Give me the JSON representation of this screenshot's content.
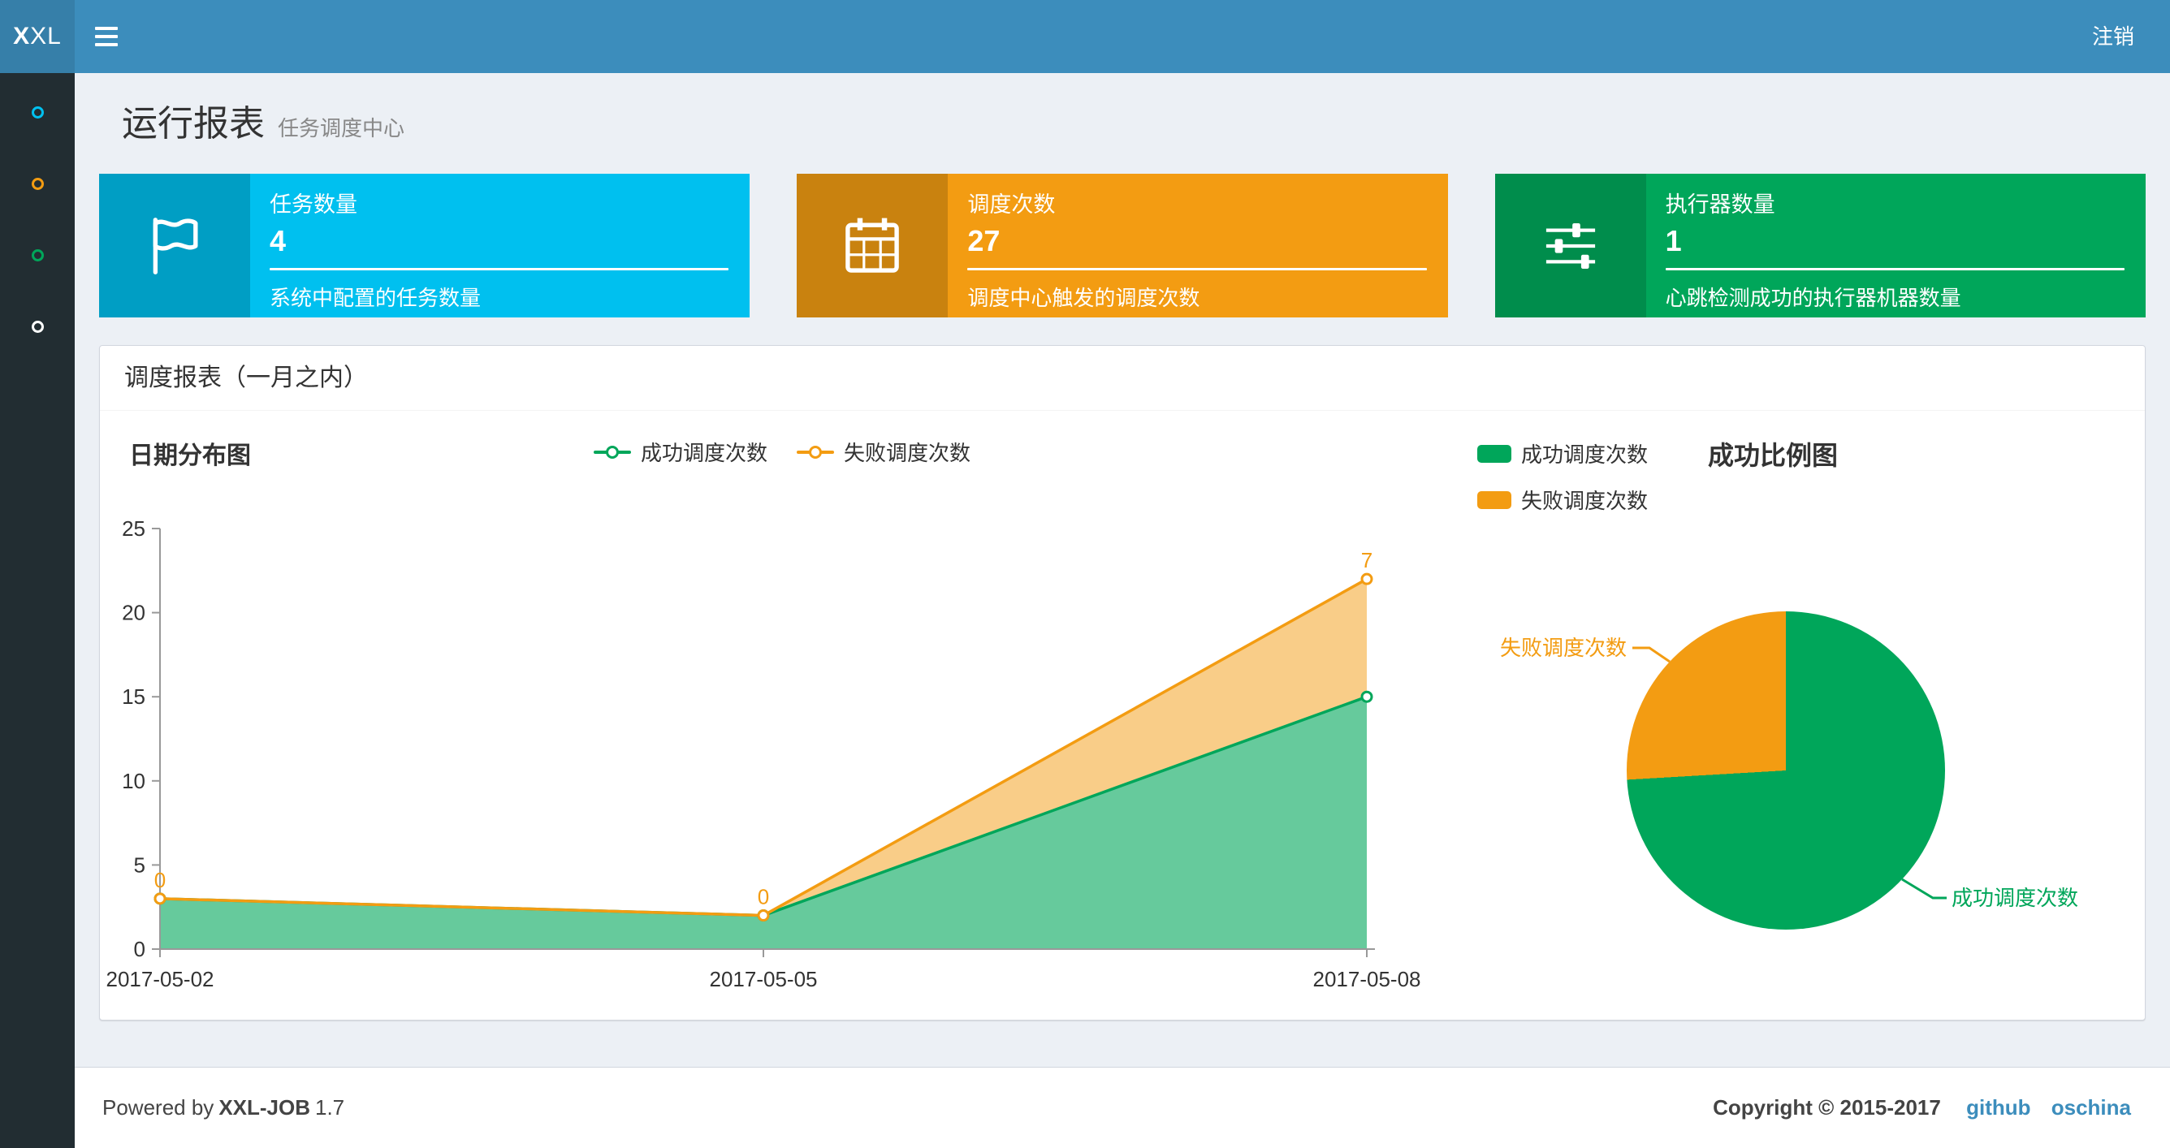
{
  "theme": {
    "navbar_bg": "#3c8dbc",
    "logo_bg": "#367fa9",
    "sidebar_bg": "#222d32",
    "content_bg": "#ecf0f5",
    "link_color": "#3c8dbc"
  },
  "navbar": {
    "logo_bold": "X",
    "logo_rest": "XL",
    "logout_label": "注销"
  },
  "sidebar": {
    "items": [
      {
        "name": "menu-item-1",
        "icon_color": "#00c0ef"
      },
      {
        "name": "menu-item-2",
        "icon_color": "#f39c12"
      },
      {
        "name": "menu-item-3",
        "icon_color": "#00a65a"
      },
      {
        "name": "menu-item-4",
        "icon_color": "#ffffff"
      }
    ]
  },
  "page": {
    "title": "运行报表",
    "subtitle": "任务调度中心"
  },
  "info_boxes": [
    {
      "title": "任务数量",
      "value": "4",
      "desc": "系统中配置的任务数量",
      "bg": "#00c0ef",
      "icon_bg": "#009ec4",
      "icon": "flag-icon"
    },
    {
      "title": "调度次数",
      "value": "27",
      "desc": "调度中心触发的调度次数",
      "bg": "#f39c12",
      "icon_bg": "#c9820f",
      "icon": "calendar-icon"
    },
    {
      "title": "执行器数量",
      "value": "1",
      "desc": "心跳检测成功的执行器机器数量",
      "bg": "#00a65a",
      "icon_bg": "#008d4c",
      "icon": "sliders-icon"
    }
  ],
  "panel": {
    "title": "调度报表（一月之内）"
  },
  "chart_data": [
    {
      "type": "area",
      "title": "日期分布图",
      "x": [
        "2017-05-02",
        "2017-05-05",
        "2017-05-08"
      ],
      "series": [
        {
          "name": "成功调度次数",
          "color": "#00a65a",
          "values": [
            3,
            2,
            15
          ]
        },
        {
          "name": "失败调度次数",
          "color": "#f39c12",
          "values": [
            0,
            0,
            7
          ],
          "stacked_on_previous": true,
          "data_labels": [
            0,
            0,
            7
          ]
        }
      ],
      "ylim": [
        0,
        25
      ],
      "yticks": [
        0,
        5,
        10,
        15,
        20,
        25
      ],
      "legend_position": "top-center",
      "grid": false
    },
    {
      "type": "pie",
      "title": "成功比例图",
      "slices": [
        {
          "name": "成功调度次数",
          "value": 20,
          "color": "#00a65a"
        },
        {
          "name": "失败调度次数",
          "value": 7,
          "color": "#f39c12"
        }
      ],
      "legend_position": "top-left"
    }
  ],
  "footer": {
    "powered_by": "Powered by",
    "product": "XXL-JOB",
    "version": "1.7",
    "copyright": "Copyright © 2015-2017",
    "links": [
      {
        "label": "github"
      },
      {
        "label": "oschina"
      }
    ]
  }
}
